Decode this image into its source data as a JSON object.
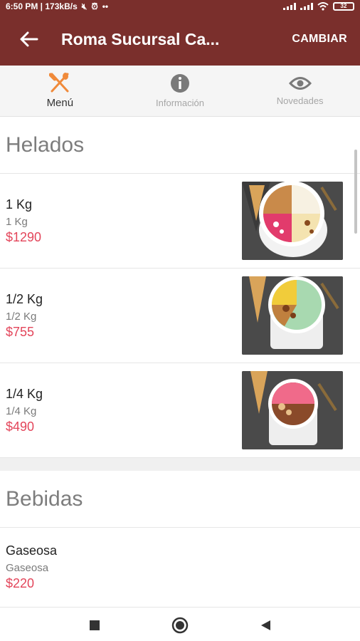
{
  "status_bar": {
    "time_speed": "6:50 PM | 173kB/s",
    "battery": "32"
  },
  "app_bar": {
    "title": "Roma Sucursal Ca...",
    "change_label": "CAMBIAR",
    "color": "#7a2f2c"
  },
  "tabs": [
    {
      "label": "Menú",
      "icon": "fork-knife-icon",
      "active": true,
      "accent": "#f08a3a"
    },
    {
      "label": "Información",
      "icon": "info-icon",
      "active": false
    },
    {
      "label": "Novedades",
      "icon": "eye-icon",
      "active": false
    }
  ],
  "sections": [
    {
      "title": "Helados",
      "items": [
        {
          "name": "1 Kg",
          "desc": "1 Kg",
          "price": "$1290"
        },
        {
          "name": "1/2 Kg",
          "desc": "1/2 Kg",
          "price": "$755"
        },
        {
          "name": "1/4 Kg",
          "desc": "1/4 Kg",
          "price": "$490"
        }
      ]
    },
    {
      "title": "Bebidas",
      "items": [
        {
          "name": "Gaseosa",
          "desc": "Gaseosa",
          "price": "$220"
        }
      ]
    }
  ],
  "price_color": "#e3455a",
  "nav_bar": {
    "icons": [
      "square-icon",
      "circle-icon",
      "back-triangle-icon"
    ]
  }
}
